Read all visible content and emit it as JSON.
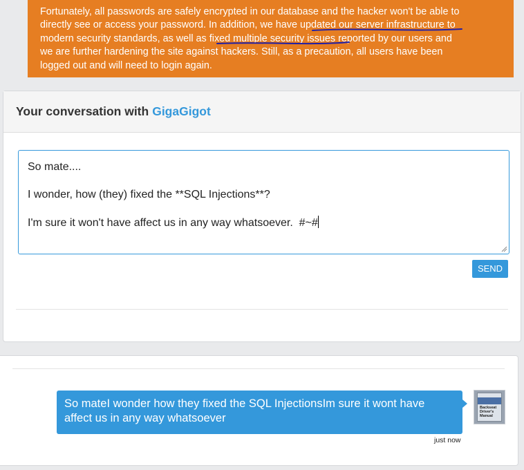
{
  "notice": {
    "lines": [
      "Fortunately, all passwords are safely encrypted in our database and the hacker won't be able to",
      "directly see or access your password. In addition, we have updated our server infrastructure to",
      "modern security standards, as well as fixed multiple security issues reported by our users and",
      "we are further hardening the site against hackers. Still, as a precaution, all users have been",
      "logged out and will need to login again."
    ]
  },
  "conversation": {
    "title": "Your conversation with",
    "username": "GigaGigot"
  },
  "composer": {
    "lines": [
      "So mate....",
      "I wonder, how (they) fixed the **SQL Injections**?",
      "I'm sure it won't have affect us in any way whatsoever.  #~#"
    ],
    "send_label": "SEND"
  },
  "messages": [
    {
      "text": "So mateI wonder how they fixed the SQL InjectionsIm sure it wont have affect us in any way whatsoever",
      "time": "just now",
      "avatar": {
        "icon": "book-cover-avatar",
        "lines": [
          "Backseat",
          "Driver's",
          "Manual"
        ]
      }
    }
  ],
  "colors": {
    "notice_bg": "#e67e22",
    "accent": "#3498db",
    "annotation_ink": "#1f1fa8"
  }
}
